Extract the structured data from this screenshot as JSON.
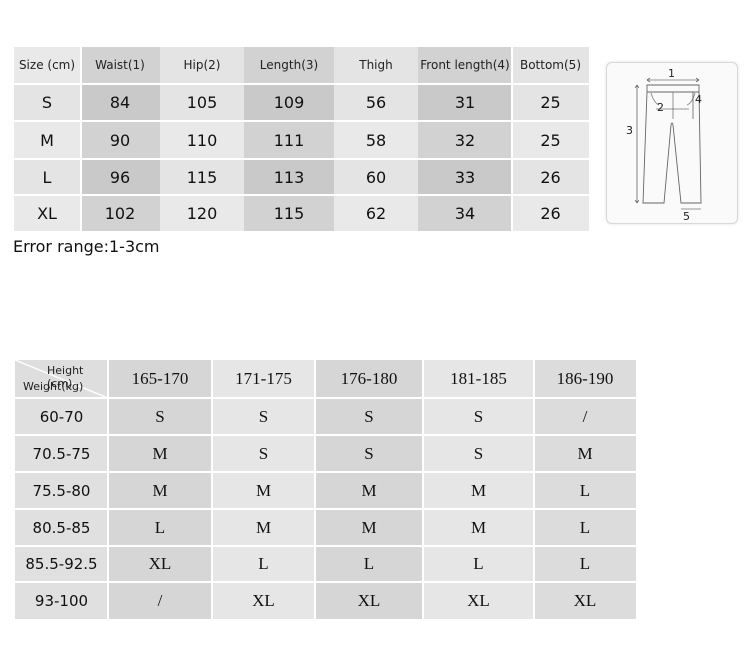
{
  "size_table": {
    "headers": [
      "Size (cm)",
      "Waist(1)",
      "Hip(2)",
      "Length(3)",
      "Thigh",
      "Front length(4)",
      "Bottom(5)"
    ],
    "rows": [
      [
        "S",
        "84",
        "105",
        "109",
        "56",
        "31",
        "25"
      ],
      [
        "M",
        "90",
        "110",
        "111",
        "58",
        "32",
        "25"
      ],
      [
        "L",
        "96",
        "115",
        "113",
        "60",
        "33",
        "26"
      ],
      [
        "XL",
        "102",
        "120",
        "115",
        "62",
        "34",
        "26"
      ]
    ]
  },
  "error_note": "Error range:1-3cm",
  "diagram": {
    "labels": [
      "1",
      "2",
      "3",
      "4",
      "5"
    ]
  },
  "hw_table": {
    "corner_height": "Height (cm)",
    "corner_weight": "Weight(kg)",
    "heights": [
      "165-170",
      "171-175",
      "176-180",
      "181-185",
      "186-190"
    ],
    "weights": [
      "60-70",
      "70.5-75",
      "75.5-80",
      "80.5-85",
      "85.5-92.5",
      "93-100"
    ],
    "grid": [
      [
        "S",
        "S",
        "S",
        "S",
        "/"
      ],
      [
        "M",
        "S",
        "S",
        "S",
        "M"
      ],
      [
        "M",
        "M",
        "M",
        "M",
        "L"
      ],
      [
        "L",
        "M",
        "M",
        "M",
        "L"
      ],
      [
        "XL",
        "L",
        "L",
        "L",
        "L"
      ],
      [
        "/",
        "XL",
        "XL",
        "XL",
        "XL"
      ]
    ]
  }
}
